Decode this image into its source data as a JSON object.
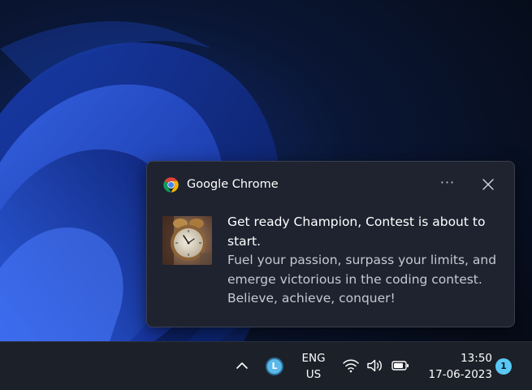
{
  "notification": {
    "app_name": "Google Chrome",
    "more_label": "···",
    "title_line1": "Get ready Champion, Contest is about to",
    "title_line2": "start.",
    "message_line1": "Fuel your passion, surpass your limits, and",
    "message_line2": "emerge victorious in the coding contest.",
    "message_line3": "Believe, achieve, conquer!",
    "image_icon": "alarm-clock-image"
  },
  "taskbar": {
    "tray_app_letter": "L",
    "language_line1": "ENG",
    "language_line2": "US",
    "time": "13:50",
    "date": "17-06-2023",
    "notification_count": "1"
  },
  "colors": {
    "accent": "#5ac8f5",
    "toast_background": "#1f2330",
    "taskbar_background": "#1c2029"
  }
}
